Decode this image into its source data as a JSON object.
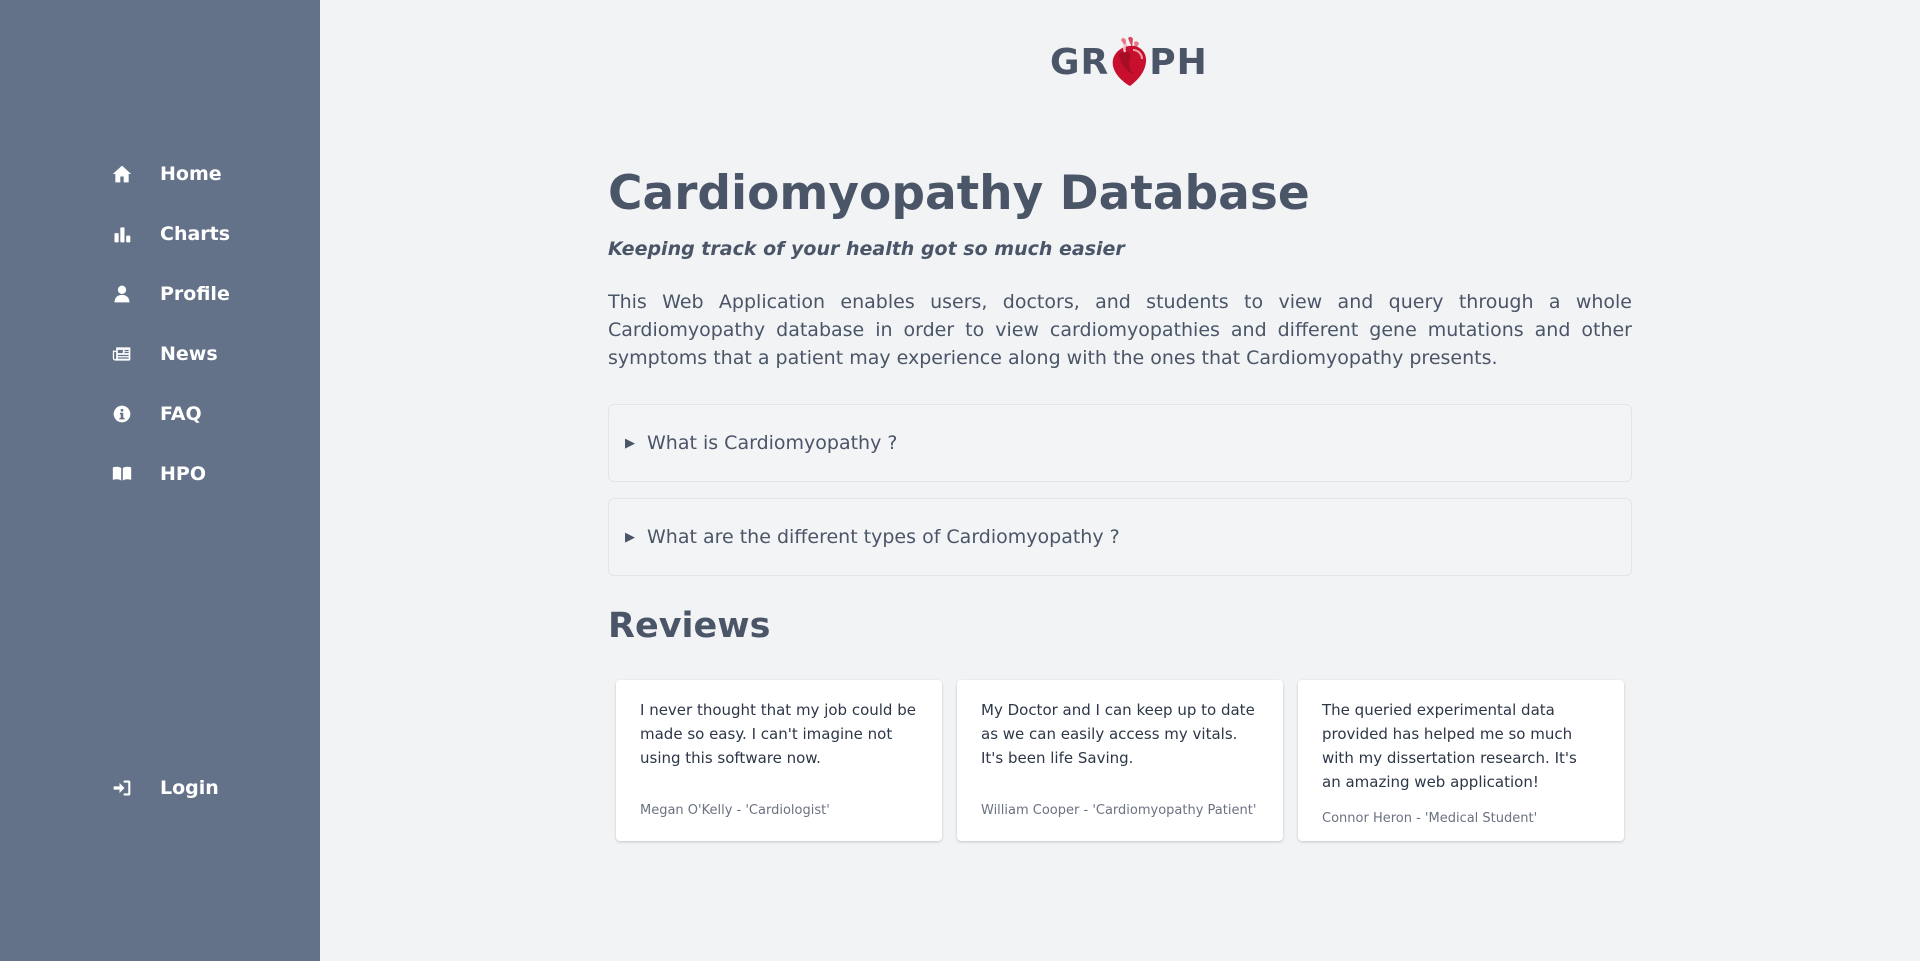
{
  "sidebar": {
    "items": [
      {
        "label": "Home",
        "icon": "home-icon"
      },
      {
        "label": "Charts",
        "icon": "chart-bar-icon"
      },
      {
        "label": "Profile",
        "icon": "user-icon"
      },
      {
        "label": "News",
        "icon": "newspaper-icon"
      },
      {
        "label": "FAQ",
        "icon": "info-circle-icon"
      },
      {
        "label": "HPO",
        "icon": "book-open-icon"
      }
    ],
    "login": {
      "label": "Login",
      "icon": "sign-in-icon"
    }
  },
  "logo": {
    "left": "GR",
    "right": "PH"
  },
  "main": {
    "title": "Cardiomyopathy Database",
    "subtitle": "Keeping track of your health got so much easier",
    "description": "This Web Application enables users, doctors, and students to view and query through a whole Cardiomyopathy database in order to view cardiomyopathies and different gene mutations and other symptoms that a patient may experience along with the ones that Cardiomyopathy presents.",
    "accordions": [
      {
        "label": "What is Cardiomyopathy ?"
      },
      {
        "label": "What are the different types of Cardiomyopathy ?"
      }
    ],
    "reviews_heading": "Reviews",
    "reviews": [
      {
        "quote": "I never thought that my job could be made so easy. I can't imagine not using this software now.",
        "author": "Megan O'Kelly - 'Cardiologist'"
      },
      {
        "quote": "My Doctor and I can keep up to date as we can easily access my vitals. It's been life Saving.",
        "author": "William Cooper - 'Cardiomyopathy Patient'"
      },
      {
        "quote": "The queried experimental data provided has helped me so much with my dissertation research. It's an amazing web application!",
        "author": "Connor Heron - 'Medical Student'"
      }
    ]
  },
  "colors": {
    "sidebar_bg": "#637289",
    "page_bg": "#f2f3f5",
    "text": "#4a5568",
    "heart": "#c8102e"
  }
}
